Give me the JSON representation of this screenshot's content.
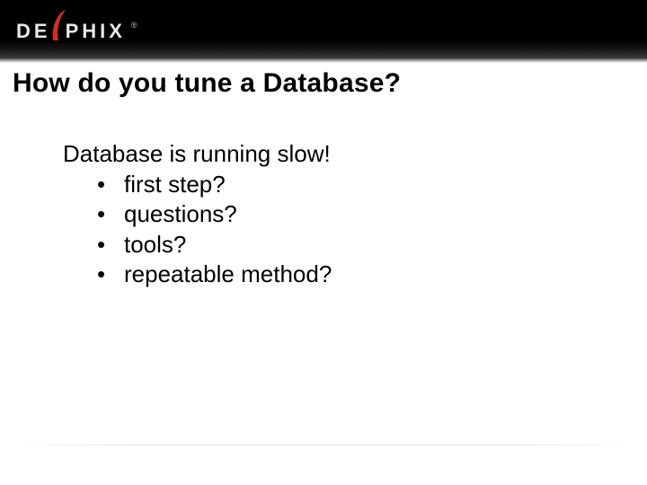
{
  "header": {
    "logo_left": "DE",
    "logo_right": "PHIX",
    "registered": "®"
  },
  "slide": {
    "title": "How do you tune a Database?",
    "lead": "Database is running slow!",
    "bullets": [
      "first step?",
      "questions?",
      "tools?",
      "repeatable method?"
    ]
  }
}
